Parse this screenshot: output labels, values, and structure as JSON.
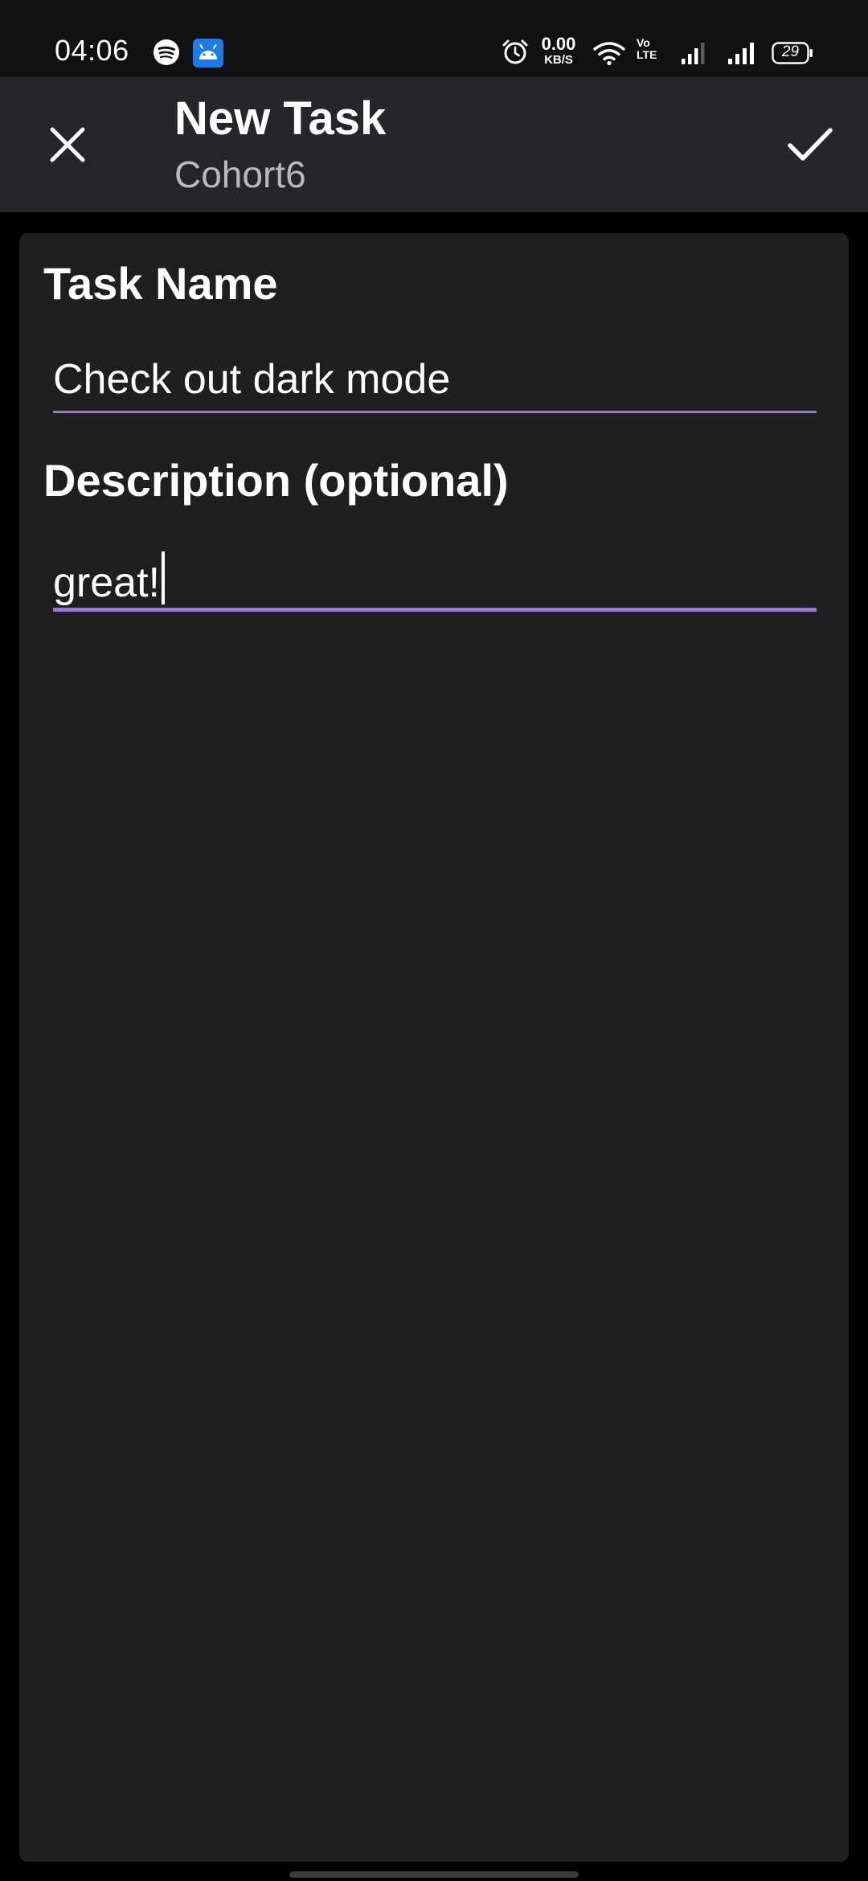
{
  "status_bar": {
    "time": "04:06",
    "net_speed_value": "0.00",
    "net_speed_unit": "KB/S",
    "volte_top": "Vo",
    "volte_bottom": "LTE",
    "battery_level": "29",
    "icons": [
      "spotify-icon",
      "android-icon",
      "alarm-icon",
      "wifi-icon",
      "signal-icon",
      "signal-icon",
      "battery-icon"
    ]
  },
  "toolbar": {
    "title": "New Task",
    "subtitle": "Cohort6",
    "close_icon": "close-icon",
    "confirm_icon": "check-icon"
  },
  "form": {
    "task_name_label": "Task Name",
    "task_name_value": "Check out dark mode",
    "description_label": "Description (optional)",
    "description_value": "great!"
  },
  "colors": {
    "background": "#000000",
    "status_bar": "#111113",
    "toolbar": "#25262b",
    "card": "#1f1f1f",
    "accent": "#9a78cc",
    "subtitle": "#b9b9be",
    "android_badge": "#1f7ae6"
  }
}
